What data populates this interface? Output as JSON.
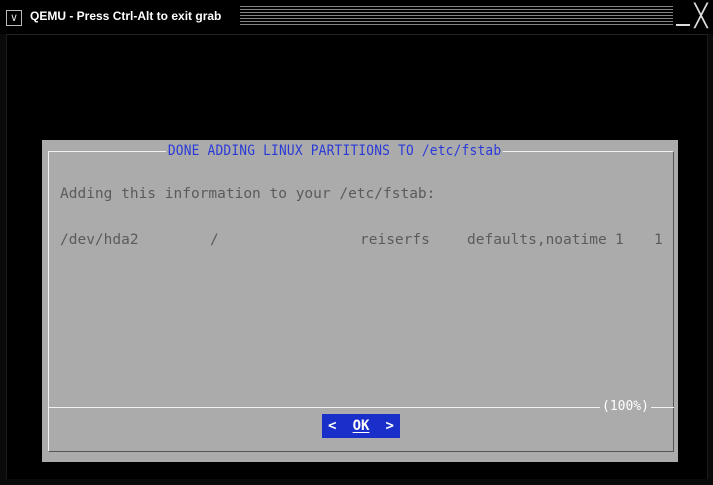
{
  "window": {
    "title": "QEMU - Press Ctrl-Alt to exit grab",
    "menu_icon": "chevron-down-icon",
    "minimize_icon": "minimize-icon",
    "close_icon": "close-icon"
  },
  "dialog": {
    "title": "DONE ADDING LINUX PARTITIONS TO /etc/fstab",
    "message": "Adding this information to your /etc/fstab:",
    "fstab_entry": {
      "device": "/dev/hda2",
      "mount_point": "/",
      "fs_type": "reiserfs",
      "options": "defaults,noatime",
      "dump": "1",
      "pass": "1"
    },
    "scroll_percent": "(100%)",
    "ok_button": {
      "left_arrow": "<",
      "label": "OK",
      "right_arrow": ">"
    }
  },
  "colors": {
    "background": "#000000",
    "dialog_bg": "#ababab",
    "title_text": "#2a3ad8",
    "body_text": "#5b5b5b",
    "button_bg": "#1a2fc9",
    "button_text": "#ffffff"
  }
}
